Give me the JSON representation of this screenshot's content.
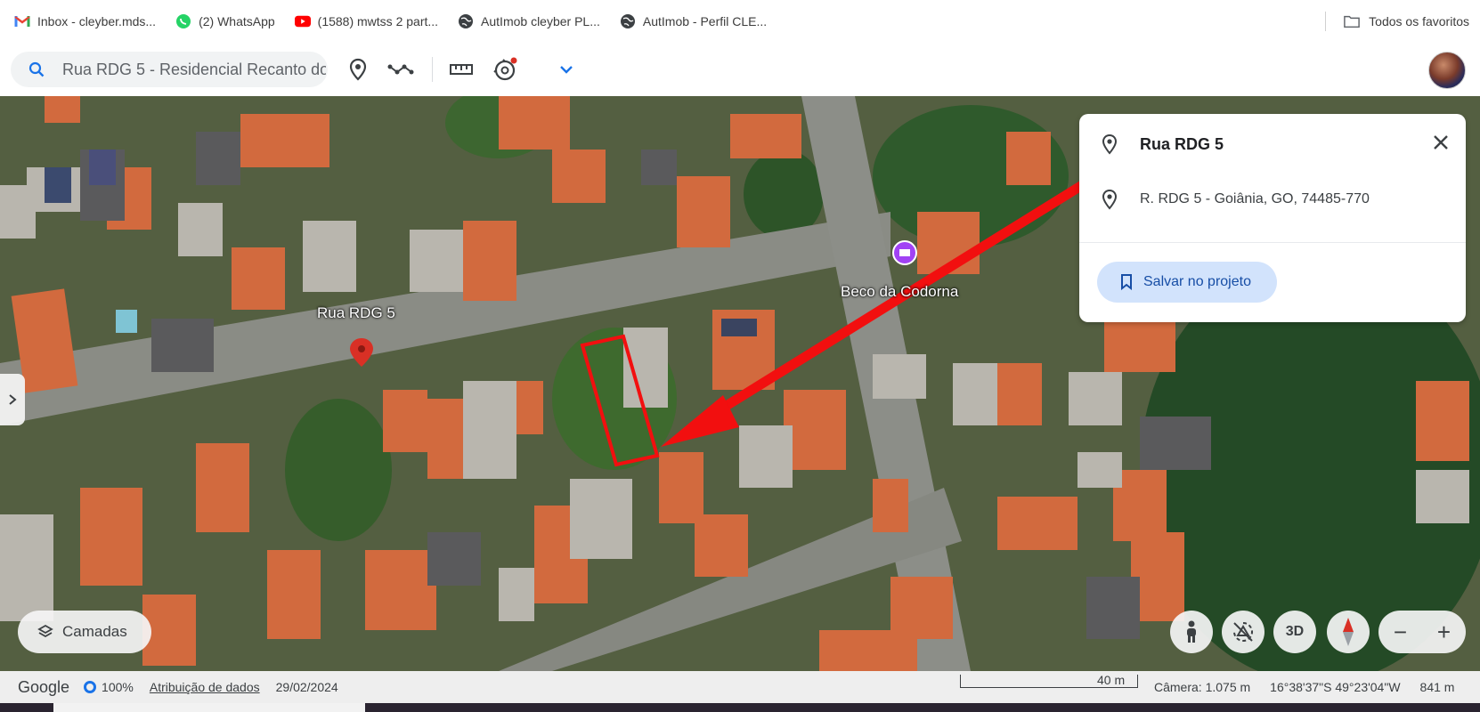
{
  "bookmarks": {
    "items": [
      {
        "label": "Inbox - cleyber.mds...",
        "icon": "gmail-icon"
      },
      {
        "label": "(2) WhatsApp",
        "icon": "whatsapp-icon"
      },
      {
        "label": "(1588) mwtss 2 part...",
        "icon": "youtube-icon"
      },
      {
        "label": "AutImob cleyber PL...",
        "icon": "globe-icon"
      },
      {
        "label": "AutImob - Perfil CLE...",
        "icon": "globe-icon"
      }
    ],
    "all_bookmarks_label": "Todos os favoritos"
  },
  "toolbar": {
    "search_value": "Rua RDG 5 - Residencial Recanto do",
    "notification_color": "#d93025"
  },
  "info_panel": {
    "title": "Rua RDG 5",
    "address": "R. RDG 5 - Goiânia, GO, 74485-770",
    "save_label": "Salvar no projeto"
  },
  "map": {
    "labels": {
      "street": "Rua RDG 5",
      "place": "Beco da Codorna"
    },
    "annotation_color": "#f20f0f",
    "pin_color": "#d93025",
    "poi_color": "#a142f4"
  },
  "controls": {
    "layers_label": "Camadas",
    "three_d_label": "3D",
    "zoom_out": "−",
    "zoom_in": "+"
  },
  "status": {
    "brand": "Google",
    "load_percent": "100%",
    "attribution": "Atribuição de dados",
    "date": "29/02/2024",
    "scale_label": "40 m",
    "camera": "Câmera: 1.075 m",
    "coords": "16°38'37\"S 49°23'04\"W",
    "elevation": "841 m"
  }
}
